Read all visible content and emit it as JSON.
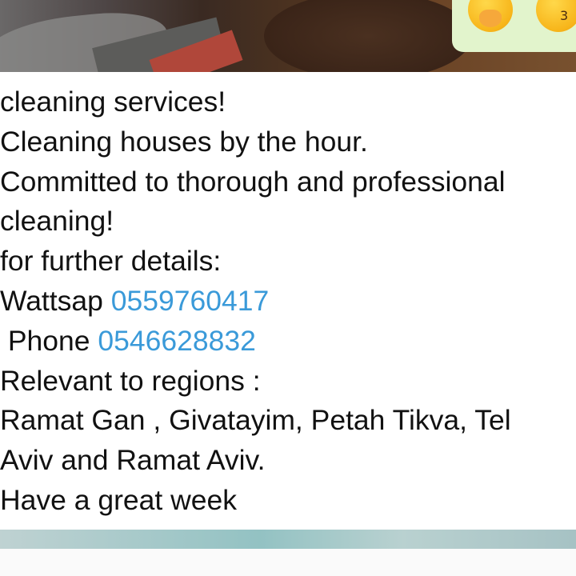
{
  "message": {
    "lines": [
      {
        "text": "cleaning services!"
      },
      {
        "text": "Cleaning houses by the hour."
      },
      {
        "text": "Committed to thorough and professional"
      },
      {
        "text": "cleaning!"
      },
      {
        "text": "for further details:"
      },
      {
        "prefix": "Wattsap ",
        "link": "0559760417"
      },
      {
        "prefix": " Phone ",
        "link": "0546628832"
      },
      {
        "text": "Relevant to regions :"
      },
      {
        "text": "Ramat Gan , Givatayim, Petah Tikva, Tel"
      },
      {
        "text": "Aviv and Ramat Aviv."
      },
      {
        "text": "Have a great week"
      }
    ]
  },
  "reactions": [
    {
      "icon": "face-with-hand-over-mouth-emoji"
    },
    {
      "icon": "kissing-face-emoji",
      "glyph": "3"
    }
  ],
  "colors": {
    "link": "#3a9ad9",
    "text": "#111111",
    "reaction_bubble": "#e2f4cc"
  }
}
